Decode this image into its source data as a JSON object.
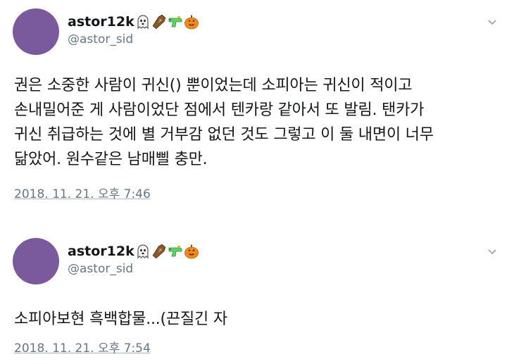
{
  "tweets": [
    {
      "display_name": "astor12k",
      "handle": "@astor_sid",
      "emoji": [
        "ghost-emoji",
        "coffin-emoji",
        "water-pistol-emoji",
        "jack-o-lantern-emoji"
      ],
      "text_lines": [
        "권은 소중한 사람이 귀신() 뿐이었는데 소피아는 귀신이 적이고",
        "손내밀어준 게 사람이었단 점에서 텐카랑 같아서 또 발림. 탠카가",
        "귀신 취급하는 것에 별 거부감 없던 것도 그렇고 이 둘 내면이 너무",
        "닮았어. 원수같은 남매삘 충만."
      ],
      "timestamp": "2018. 11. 21. 오후 7:46"
    },
    {
      "display_name": "astor12k",
      "handle": "@astor_sid",
      "emoji": [
        "ghost-emoji",
        "coffin-emoji",
        "water-pistol-emoji",
        "jack-o-lantern-emoji"
      ],
      "text_lines": [
        "소피아보현 흑백합물...(끈질긴 자"
      ],
      "timestamp": "2018. 11. 21. 오후 7:54"
    }
  ],
  "colors": {
    "avatar": "#7a5a9c",
    "text": "#14171a",
    "secondary": "#657786"
  }
}
